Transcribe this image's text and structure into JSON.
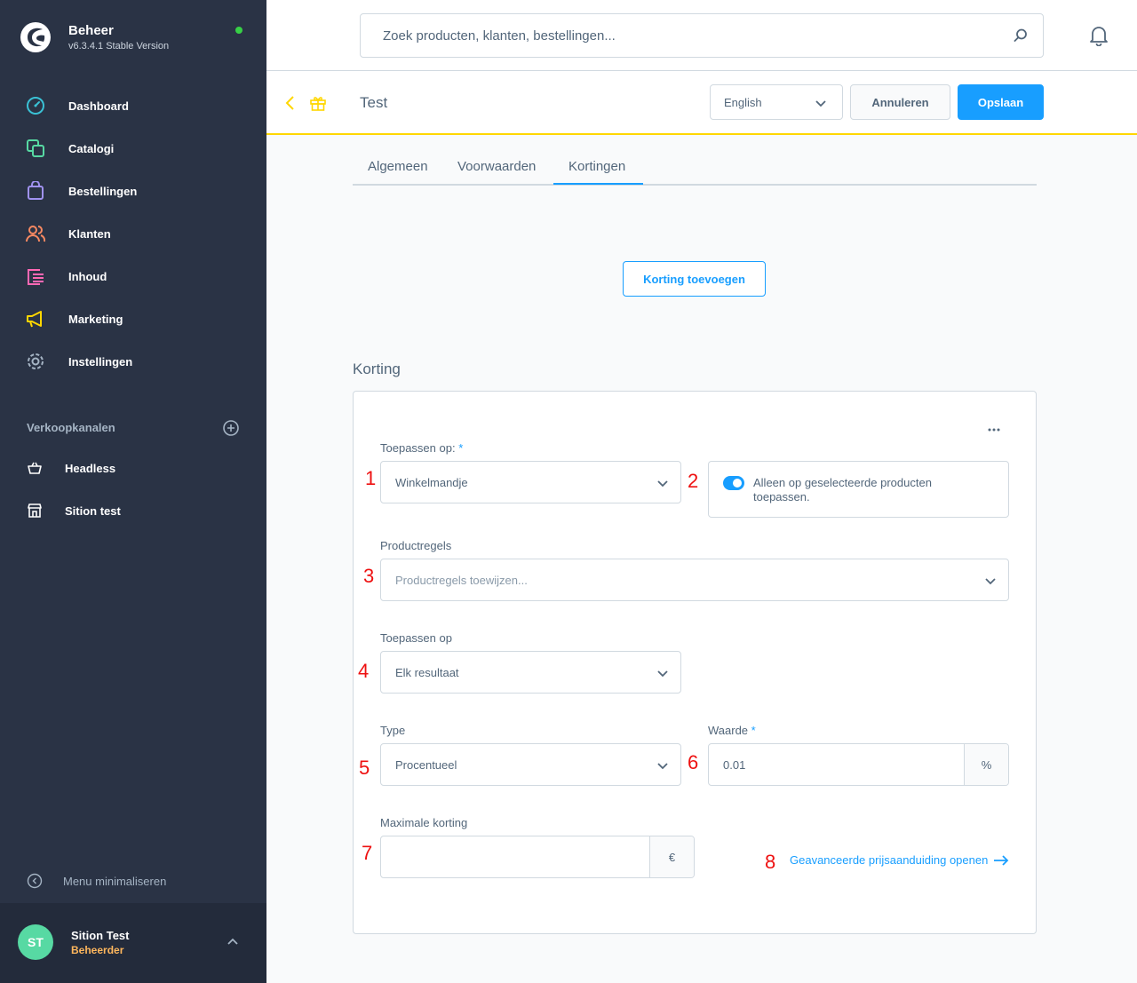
{
  "sidebar": {
    "brand_name": "Beheer",
    "version": "v6.3.4.1 Stable Version",
    "nav": [
      {
        "label": "Dashboard",
        "icon": "dashboard-icon",
        "color": "#3ac1d5"
      },
      {
        "label": "Catalogi",
        "icon": "catalog-icon",
        "color": "#57d9a3"
      },
      {
        "label": "Bestellingen",
        "icon": "shopping-bag-icon",
        "color": "#a092f0"
      },
      {
        "label": "Klanten",
        "icon": "customers-icon",
        "color": "#f88962"
      },
      {
        "label": "Inhoud",
        "icon": "content-icon",
        "color": "#ff68b4"
      },
      {
        "label": "Marketing",
        "icon": "megaphone-icon",
        "color": "#ffd700"
      },
      {
        "label": "Instellingen",
        "icon": "gear-icon",
        "color": "#a5b4c4"
      }
    ],
    "sales_channels_title": "Verkoopkanalen",
    "channels": [
      {
        "label": "Headless",
        "icon": "basket-icon"
      },
      {
        "label": "Sition test",
        "icon": "storefront-icon"
      }
    ],
    "minimize_label": "Menu minimaliseren",
    "user": {
      "initials": "ST",
      "name": "Sition Test",
      "role": "Beheerder"
    }
  },
  "search": {
    "placeholder": "Zoek producten, klanten, bestellingen..."
  },
  "smartbar": {
    "title": "Test",
    "language": "English",
    "cancel_label": "Annuleren",
    "save_label": "Opslaan"
  },
  "tabs": [
    {
      "label": "Algemeen",
      "active": false
    },
    {
      "label": "Voorwaarden",
      "active": false
    },
    {
      "label": "Kortingen",
      "active": true
    }
  ],
  "add_discount_label": "Korting toevoegen",
  "discount": {
    "title": "Korting",
    "apply_on_label": "Toepassen op:",
    "apply_on_value": "Winkelmandje",
    "only_selected_label": "Alleen op geselecteerde producten toepassen.",
    "only_selected_enabled": true,
    "product_rules_label": "Productregels",
    "product_rules_placeholder": "Productregels toewijzen...",
    "apply_to_label": "Toepassen op",
    "apply_to_value": "Elk resultaat",
    "type_label": "Type",
    "type_value": "Procentueel",
    "value_label": "Waarde",
    "value_value": "0.01",
    "value_suffix": "%",
    "max_label": "Maximale korting",
    "max_value": "",
    "max_suffix": "€",
    "advanced_link": "Geavanceerde prijsaanduiding openen",
    "required_marker": "*"
  },
  "annotations": [
    "1",
    "2",
    "3",
    "4",
    "5",
    "6",
    "7",
    "8"
  ],
  "colors": {
    "sidebar_bg": "#2a3345",
    "accent": "#189eff",
    "smartbar_border": "#ffd700",
    "annotation": "#ee1111"
  }
}
